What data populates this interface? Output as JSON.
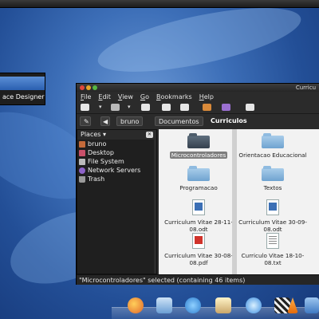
{
  "popup_menu": {
    "items": [
      "",
      "ace Designer"
    ]
  },
  "window": {
    "title": "Curricu",
    "menu": [
      "File",
      "Edit",
      "View",
      "Go",
      "Bookmarks",
      "Help"
    ],
    "breadcrumb": {
      "home": "bruno",
      "parent": "Documentos",
      "current": "Curriculos"
    }
  },
  "sidebar": {
    "header": "Places ▾",
    "items": [
      {
        "label": "bruno",
        "icon": "home-icon"
      },
      {
        "label": "Desktop",
        "icon": "desktop-icon"
      },
      {
        "label": "File System",
        "icon": "drive-icon"
      },
      {
        "label": "Network Servers",
        "icon": "network-icon"
      },
      {
        "label": "Trash",
        "icon": "trash-icon"
      }
    ]
  },
  "files": [
    {
      "name": "Microcontroladores",
      "type": "folder-dark",
      "selected": true
    },
    {
      "name": "Orientacao Educacional",
      "type": "folder"
    },
    {
      "name": "Programacao",
      "type": "folder"
    },
    {
      "name": "Textos",
      "type": "folder"
    },
    {
      "name": "Curriculum Vitae 28-11-08.odt",
      "type": "odt"
    },
    {
      "name": "Curriculum Vitae 30-09-08.odt",
      "type": "odt"
    },
    {
      "name": "Curriculum Vitae 30-08-08.pdf",
      "type": "pdf"
    },
    {
      "name": "Curriculo Vitae 18-10-08.txt",
      "type": "txt"
    }
  ],
  "status": "\"Microcontroladores\" selected (containing 46 items)",
  "dock": {
    "icons": [
      "thunderbird-icon",
      "mail-icon",
      "chat-icon",
      "weather-icon",
      "music-icon",
      "clapper-icon",
      "vlc-icon",
      "finder-icon"
    ]
  }
}
